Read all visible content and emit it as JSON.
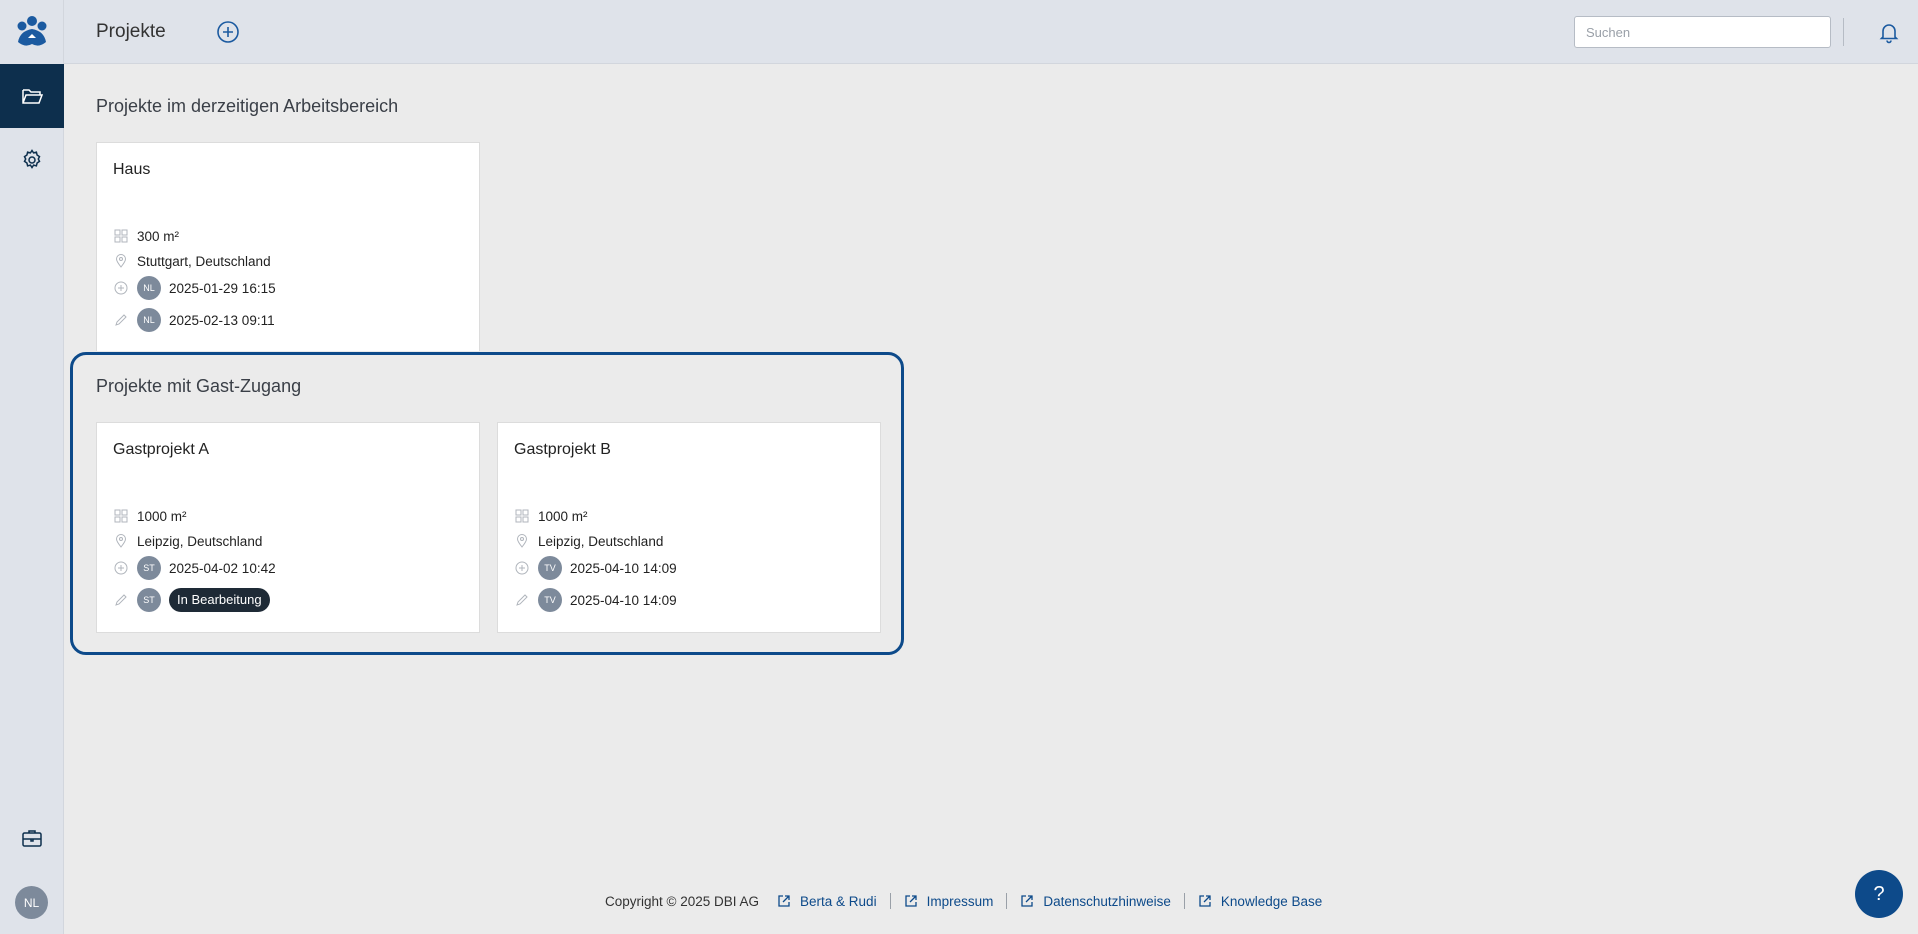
{
  "header": {
    "title": "Projekte",
    "search_placeholder": "Suchen",
    "icons": [
      "add-project-icon",
      "bell-icon"
    ]
  },
  "sidebar": {
    "items": [
      {
        "icon": "folder-icon",
        "active": true
      },
      {
        "icon": "gear-icon",
        "active": false
      },
      {
        "icon": "briefcase-icon",
        "active": false
      }
    ],
    "user_initials": "NL"
  },
  "sections": {
    "workspace": {
      "title": "Projekte im derzeitigen Arbeitsbereich",
      "projects": [
        {
          "name": "Haus",
          "area": "300 m²",
          "location": "Stuttgart, Deutschland",
          "created_by": "NL",
          "created_at": "2025-01-29 16:15",
          "edited_by": "NL",
          "edited_at": "2025-02-13 09:11"
        }
      ]
    },
    "guest": {
      "title": "Projekte mit Gast-Zugang",
      "projects": [
        {
          "name": "Gastprojekt A",
          "area": "1000 m²",
          "location": "Leipzig, Deutschland",
          "created_by": "ST",
          "created_at": "2025-04-02 10:42",
          "edited_by": "ST",
          "status": "In Bearbeitung"
        },
        {
          "name": "Gastprojekt B",
          "area": "1000 m²",
          "location": "Leipzig, Deutschland",
          "created_by": "TV",
          "created_at": "2025-04-10 14:09",
          "edited_by": "TV",
          "edited_at": "2025-04-10 14:09"
        }
      ]
    }
  },
  "footer": {
    "copyright": "Copyright © 2025 DBI AG",
    "links": [
      "Berta & Rudi",
      "Impressum",
      "Datenschutzhinweise",
      "Knowledge Base"
    ]
  },
  "help_label": "?",
  "colors": {
    "accent": "#0d4a8a",
    "sidebar_active": "#0d2f4d",
    "avatar": "#7d8a9b",
    "status_pill": "#1e2a36"
  }
}
